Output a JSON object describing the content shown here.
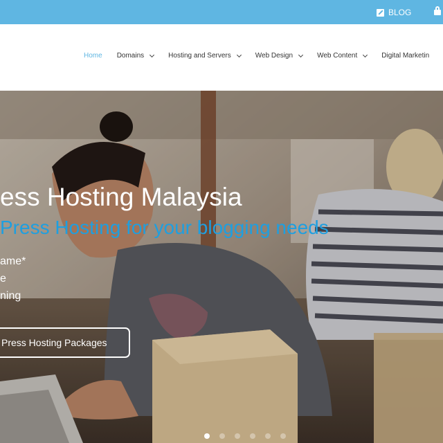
{
  "topbar": {
    "blog_label": "BLOG",
    "blog_icon": "edit-icon",
    "lock_icon": "lock-icon",
    "color": "#5fb6e2"
  },
  "nav": {
    "items": [
      {
        "label": "Home",
        "active": true
      },
      {
        "label": "Domains",
        "dropdown": true
      },
      {
        "label": "Hosting and Servers",
        "dropdown": true
      },
      {
        "label": "Web Design",
        "dropdown": true
      },
      {
        "label": "Web Content",
        "dropdown": true
      },
      {
        "label": "Digital Marketin",
        "dropdown": false
      }
    ]
  },
  "hero": {
    "title": "ess Hosting Malaysia",
    "subtitle": "Press Hosting for your blogging needs",
    "features": [
      "ame*",
      "e",
      "ning"
    ],
    "cta_label": "Press Hosting Packages",
    "slides_total": 6,
    "slide_active": 1
  },
  "colors": {
    "accent": "#1e9fe0",
    "nav_active": "#5fb6e2"
  }
}
